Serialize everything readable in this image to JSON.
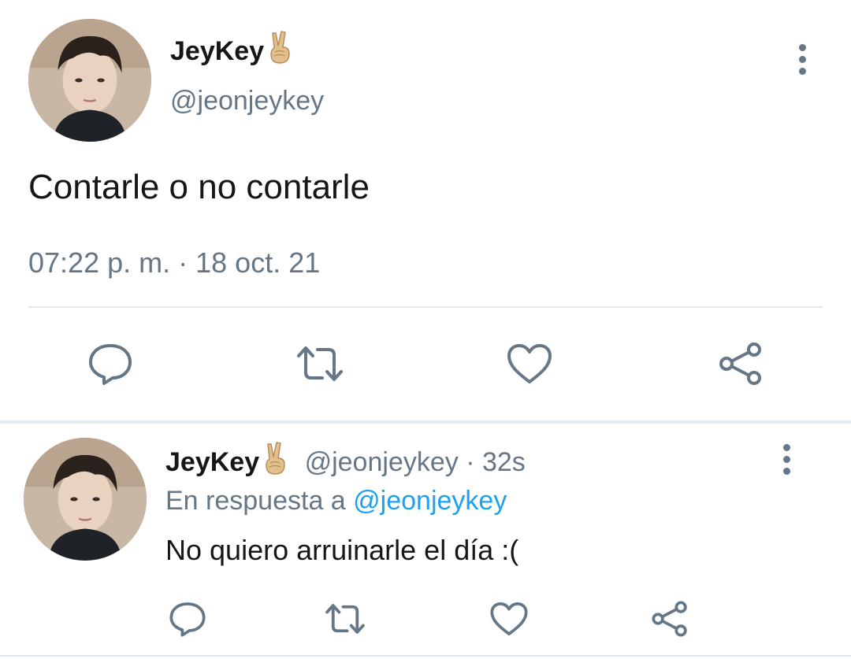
{
  "main_tweet": {
    "display_name": "JeyKey",
    "badge_emoji": "✌️",
    "handle": "@jeonjeykey",
    "text": "Contarle o no contarle",
    "time": "07:22 p. m.",
    "separator": "·",
    "date": "18 oct. 21",
    "actions": [
      "reply-icon",
      "retweet-icon",
      "like-icon",
      "share-icon"
    ]
  },
  "reply_tweet": {
    "display_name": "JeyKey",
    "badge_emoji": "✌️",
    "handle": "@jeonjeykey",
    "separator": "·",
    "age": "32s",
    "reply_prefix": "En respuesta a",
    "reply_to": "@jeonjeykey",
    "text": "No quiero arruinarle el día :(",
    "actions": [
      "reply-icon",
      "retweet-icon",
      "like-icon",
      "share-icon"
    ]
  },
  "colors": {
    "text_primary": "#14171a",
    "text_secondary": "#657786",
    "link": "#1da1f2",
    "divider": "#e1e8ed"
  }
}
